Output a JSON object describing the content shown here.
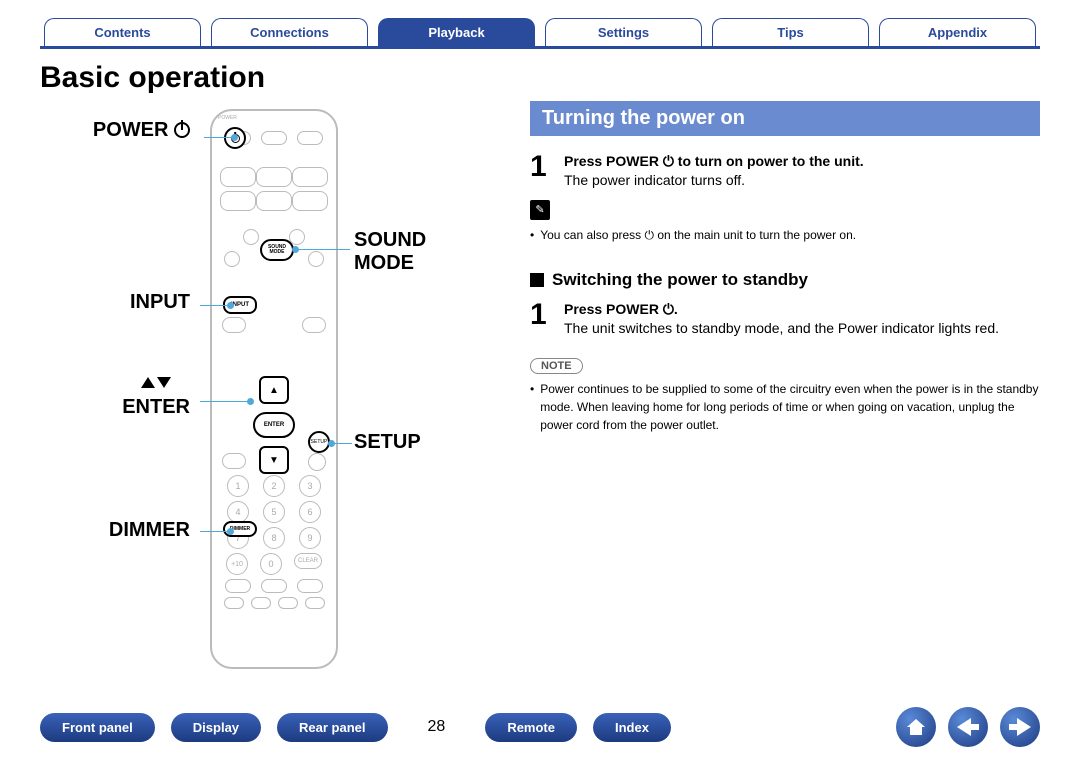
{
  "tabs": [
    "Contents",
    "Connections",
    "Playback",
    "Settings",
    "Tips",
    "Appendix"
  ],
  "active_tab": 2,
  "title": "Basic operation",
  "labels": {
    "power": "POWER",
    "sound_mode_l1": "SOUND",
    "sound_mode_l2": "MODE",
    "input": "INPUT",
    "enter": "ENTER",
    "setup": "SETUP",
    "dimmer": "DIMMER"
  },
  "remote_btn": {
    "sound_mode": "SOUND MODE",
    "input": "INPUT",
    "enter": "ENTER",
    "setup": "SETUP",
    "dimmer": "DIMMER",
    "power": "POWER"
  },
  "section": {
    "heading": "Turning the power on",
    "step1_bold": "Press POWER ⏻ to turn on power to the unit.",
    "step1_text": "The power indicator turns off.",
    "tip_text": "You can also press ⏻ on the main unit to turn the power on.",
    "sub_heading": "Switching the power to standby",
    "step2_bold": "Press POWER ⏻.",
    "step2_text": "The unit switches to standby mode, and the Power indicator lights red.",
    "note_label": "NOTE",
    "note_text": "Power continues to be supplied to some of the circuitry even when the power is in the standby mode. When leaving home for long periods of time or when going on vacation, unplug the power cord from the power outlet."
  },
  "footer": {
    "buttons": [
      "Front panel",
      "Display",
      "Rear panel",
      "Remote",
      "Index"
    ],
    "page": "28"
  }
}
